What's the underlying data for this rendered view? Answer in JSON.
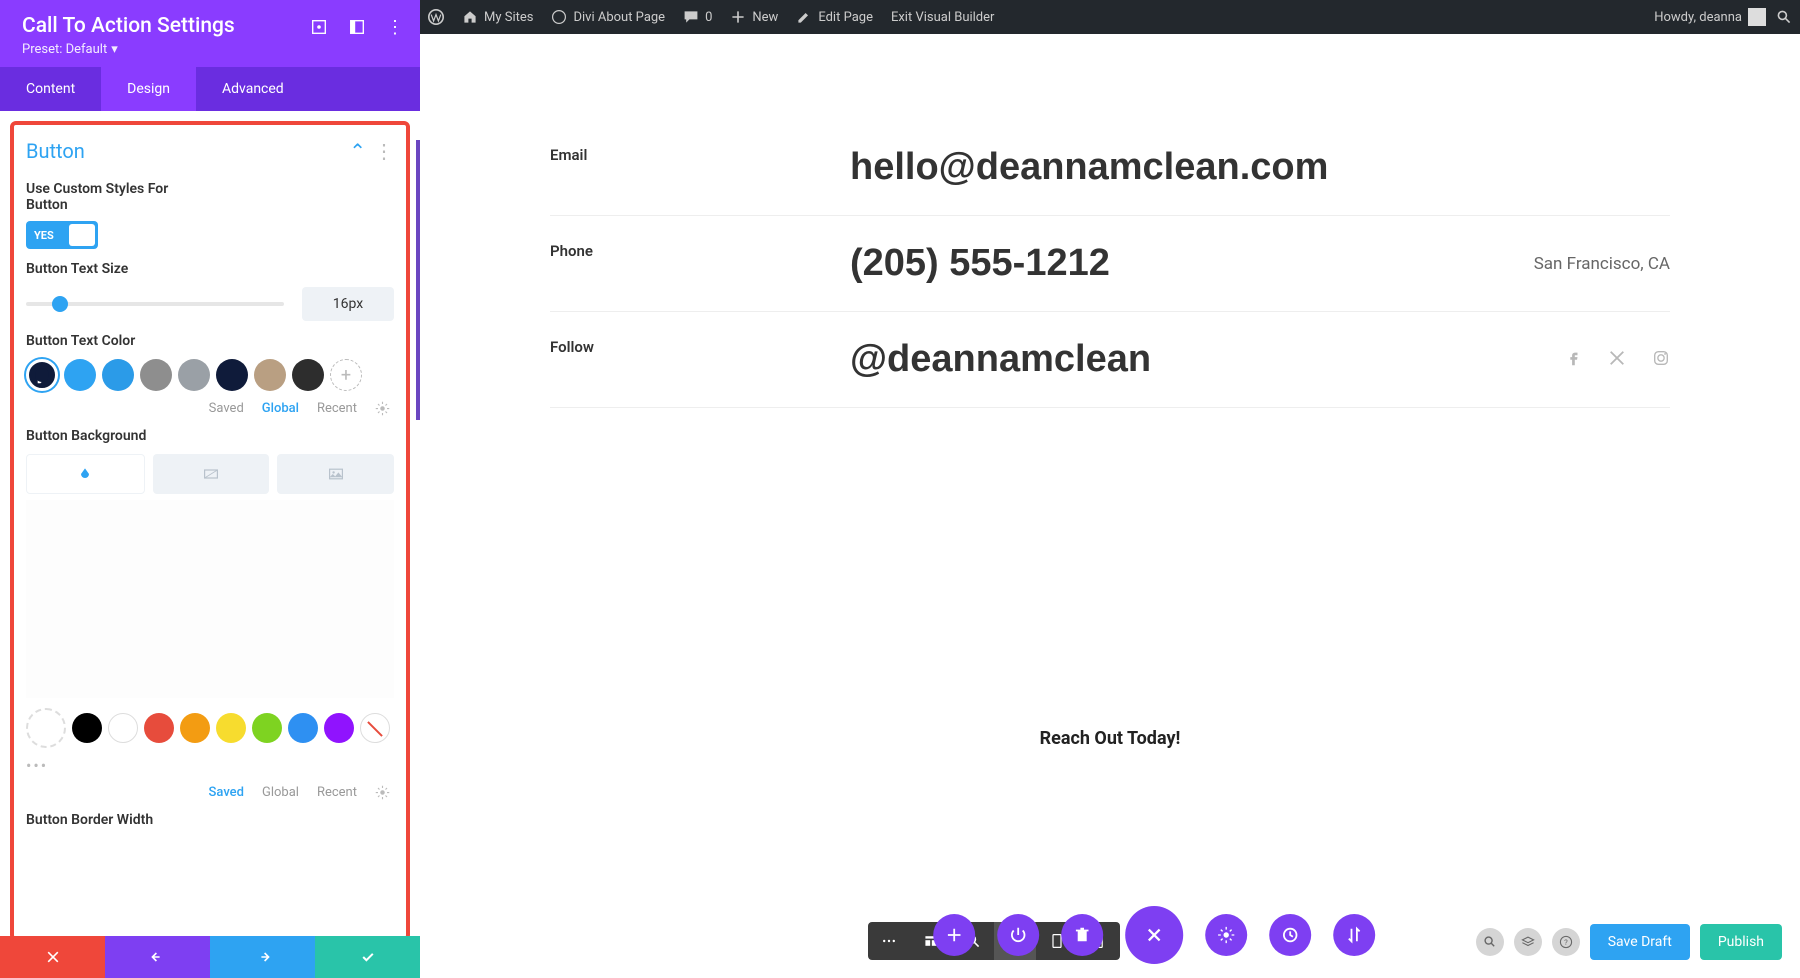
{
  "adminbar": {
    "my_sites": "My Sites",
    "site_name": "Divi About Page",
    "comments": "0",
    "new": "New",
    "edit_page": "Edit Page",
    "exit_vb": "Exit Visual Builder",
    "howdy": "Howdy, deanna"
  },
  "sidebar": {
    "title": "Call To Action Settings",
    "preset": "Preset: Default",
    "tabs": {
      "content": "Content",
      "design": "Design",
      "advanced": "Advanced"
    },
    "section_title": "Button",
    "custom_styles_label": "Use Custom Styles For Button",
    "toggle_yes": "YES",
    "text_size_label": "Button Text Size",
    "text_size_value": "16px",
    "text_color_label": "Button Text Color",
    "palette_tabs": {
      "saved": "Saved",
      "global": "Global",
      "recent": "Recent"
    },
    "bg_label": "Button Background",
    "bg_palette_tabs": {
      "saved": "Saved",
      "global": "Global",
      "recent": "Recent"
    },
    "border_width_label": "Button Border Width",
    "text_colors": [
      "#2ea3f2",
      "#2b9be8",
      "#8e8e8e",
      "#9aa0a6",
      "#0f1b3a",
      "#b99f82",
      "#2d2d2d"
    ],
    "bg_colors": [
      "#000000",
      "#ffffff",
      "#e74c3c",
      "#f39c12",
      "#f7dc2e",
      "#7ed321",
      "#2e90f2",
      "#9013fe"
    ]
  },
  "preview": {
    "email_label": "Email",
    "email_value": "hello@deannamclean.com",
    "phone_label": "Phone",
    "phone_value": "(205) 555-1212",
    "location": "San Francisco, CA",
    "follow_label": "Follow",
    "follow_value": "@deannamclean",
    "cta": "Reach Out Today!"
  },
  "footer": {
    "save_draft": "Save Draft",
    "publish": "Publish"
  }
}
